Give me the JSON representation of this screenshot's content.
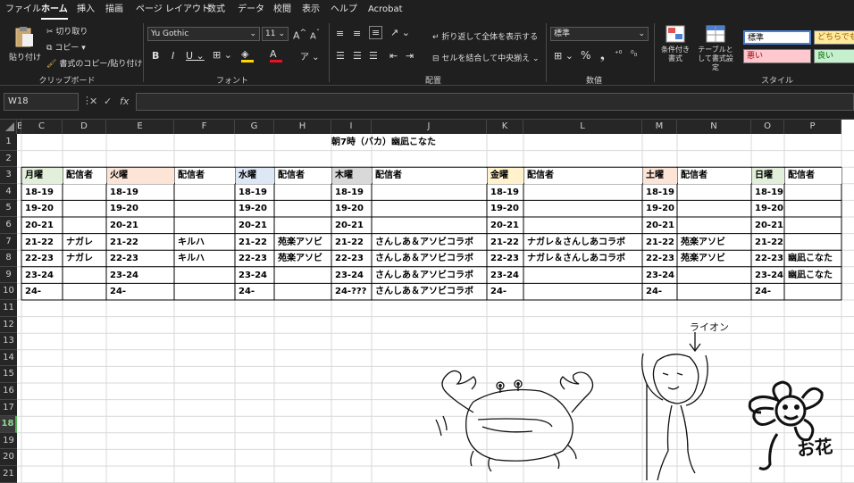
{
  "menu": [
    "ファイル",
    "ホーム",
    "挿入",
    "描画",
    "ページ レイアウト",
    "数式",
    "データ",
    "校閲",
    "表示",
    "ヘルプ",
    "Acrobat"
  ],
  "ribbon": {
    "paste": "貼り付け",
    "cut": "切り取り",
    "copy": "コピー",
    "format_painter": "書式のコピー/貼り付け",
    "clipboard_group": "クリップボード",
    "font_name": "Yu Gothic",
    "font_size": "11",
    "font_group": "フォント",
    "wrap_text": "折り返して全体を表示する",
    "merge_center": "セルを結合して中央揃え",
    "alignment_group": "配置",
    "number_format": "標準",
    "number_group": "数値",
    "conditional_format": "条件付き書式",
    "table_format": "テーブルとして書式設定",
    "styles_group": "スタイル",
    "style_normal": "標準",
    "style_neutral": "どちらでも",
    "style_bad": "悪い",
    "style_good": "良い"
  },
  "formula_bar": {
    "cell": "W18",
    "fx": "fx",
    "value": ""
  },
  "columns": [
    "B",
    "C",
    "D",
    "E",
    "F",
    "G",
    "H",
    "I",
    "J",
    "K",
    "L",
    "M",
    "N",
    "O",
    "P"
  ],
  "rows": [
    "1",
    "2",
    "3",
    "4",
    "5",
    "6",
    "7",
    "8",
    "9",
    "10",
    "11",
    "12",
    "13",
    "14",
    "15",
    "16",
    "17",
    "18",
    "19",
    "20",
    "21"
  ],
  "selected_row": "18",
  "sheet": {
    "title": "朝7時（バカ）幽凪こなた",
    "headers": [
      "月曜",
      "配信者",
      "火曜",
      "配信者",
      "水曜",
      "配信者",
      "木曜",
      "配信者",
      "金曜",
      "配信者",
      "土曜",
      "配信者",
      "日曜",
      "配信者"
    ],
    "header_colors": [
      "#e2efda",
      "#ffffff",
      "#fce4d6",
      "#ffffff",
      "#dde7f6",
      "#ffffff",
      "#d9d9d9",
      "#ffffff",
      "#fff2cc",
      "#ffffff",
      "#fce4d6",
      "#ffffff",
      "#e2efda",
      "#ffffff"
    ],
    "rows": [
      [
        "18-19",
        "",
        "18-19",
        "",
        "18-19",
        "",
        "18-19",
        "",
        "18-19",
        "",
        "18-19",
        "",
        "18-19",
        ""
      ],
      [
        "19-20",
        "",
        "19-20",
        "",
        "19-20",
        "",
        "19-20",
        "",
        "19-20",
        "",
        "19-20",
        "",
        "19-20",
        ""
      ],
      [
        "20-21",
        "",
        "20-21",
        "",
        "20-21",
        "",
        "20-21",
        "",
        "20-21",
        "",
        "20-21",
        "",
        "20-21",
        ""
      ],
      [
        "21-22",
        "ナガレ",
        "21-22",
        "キルハ",
        "21-22",
        "苑楽アソビ",
        "21-22",
        "さんしあ＆アソビコラボ",
        "21-22",
        "ナガレ＆さんしあコラボ",
        "21-22",
        "苑楽アソビ",
        "21-22",
        ""
      ],
      [
        "22-23",
        "ナガレ",
        "22-23",
        "キルハ",
        "22-23",
        "苑楽アソビ",
        "22-23",
        "さんしあ＆アソビコラボ",
        "22-23",
        "ナガレ＆さんしあコラボ",
        "22-23",
        "苑楽アソビ",
        "22-23",
        "幽凪こなた"
      ],
      [
        "23-24",
        "",
        "23-24",
        "",
        "23-24",
        "",
        "23-24",
        "さんしあ＆アソビコラボ",
        "23-24",
        "",
        "23-24",
        "",
        "23-24",
        "幽凪こなた"
      ],
      [
        "24-",
        "",
        "24-",
        "",
        "24-",
        "",
        "24-???",
        "さんしあ＆アソビコラボ",
        "24-",
        "",
        "24-",
        "",
        "24-",
        ""
      ]
    ]
  },
  "drawings": {
    "lion_label": "ライオン",
    "flower_text": "お花"
  }
}
